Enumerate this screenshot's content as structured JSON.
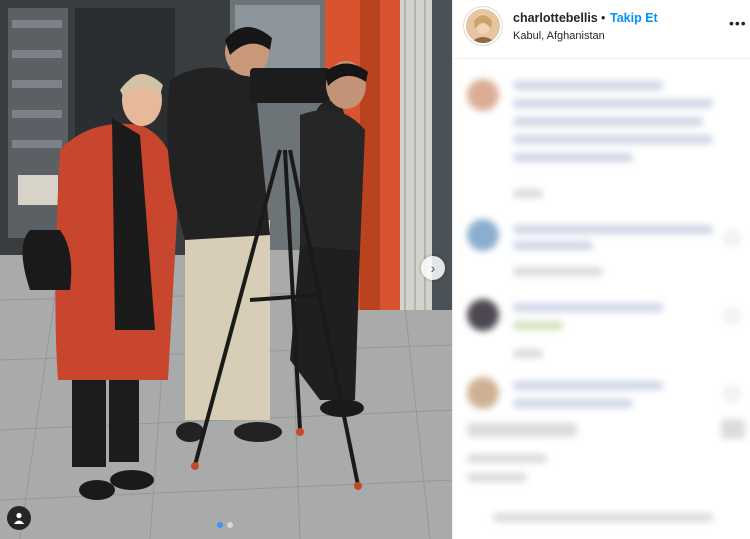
{
  "post": {
    "photo_description_label": "",
    "carousel": {
      "active_index": 0,
      "count": 2
    }
  },
  "header": {
    "username": "charlottebellis",
    "separator": "•",
    "follow_label": "Takip Et",
    "location": "Kabul, Afghanistan",
    "more_icon": "more-options-icon"
  },
  "icons": {
    "next": "chevron-right-icon",
    "tag": "user-tag-icon"
  },
  "colors": {
    "follow_blue": "#0095f6",
    "carousel_active": "#3897f0",
    "coat_orange": "#c8452e"
  }
}
